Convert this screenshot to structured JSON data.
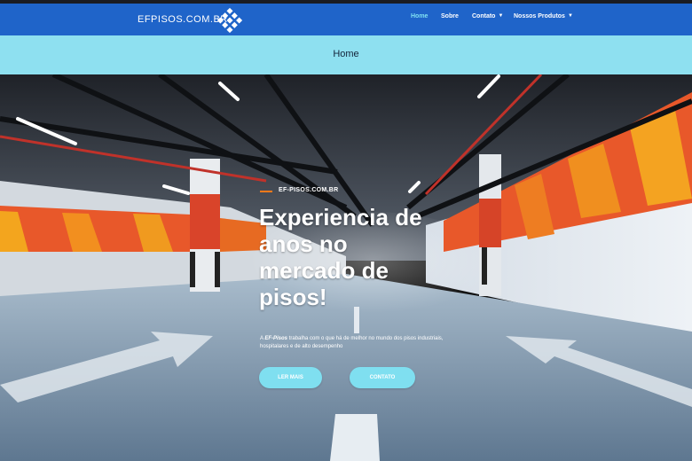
{
  "navbar": {
    "brand": "EFPISOS.COM.BR",
    "links": [
      {
        "label": "Home",
        "active": true,
        "dropdown": false
      },
      {
        "label": "Sobre",
        "active": false,
        "dropdown": false
      },
      {
        "label": "Contato",
        "active": false,
        "dropdown": true
      },
      {
        "label": "Nossos Produtos",
        "active": false,
        "dropdown": true
      }
    ],
    "caret_icon": "chevron-down-icon"
  },
  "breadcrumb": {
    "title": "Home"
  },
  "hero": {
    "eyebrow": "EF-PISOS.COM.BR",
    "headline": "Experiencia de anos no mercado de pisos!",
    "description_prefix": "A",
    "description_brand": "EF-Pisos",
    "description_rest": "trabalha com o que há de melhor no mundo dos pisos industriais, hospitalares e de alto desempenho",
    "btn_primary": "LER MAIS",
    "btn_secondary": "CONTATO"
  },
  "colors": {
    "navbar": "#1f64c9",
    "breadcrumb_bar": "#8ee0f0",
    "button": "#7fdff0",
    "accent": "#ff7a1a",
    "active_link": "#7fe0f2"
  }
}
